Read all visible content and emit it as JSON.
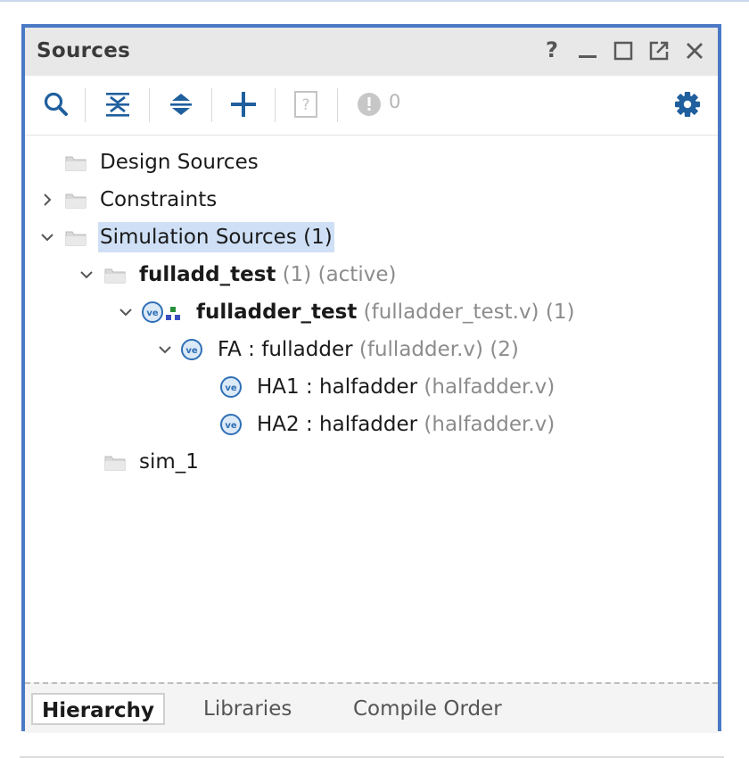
{
  "panel": {
    "title": "Sources",
    "window_controls": [
      "help-icon",
      "minimize-icon",
      "maximize-icon",
      "float-icon",
      "close-icon"
    ],
    "help_label": "?"
  },
  "toolbar": {
    "buttons": [
      "search-icon",
      "collapse-all-icon",
      "expand-all-icon",
      "add-icon",
      "unknown-file-icon",
      "status-dot-icon",
      "gear-icon"
    ],
    "status_count": "0"
  },
  "tree": {
    "design_sources": "Design Sources",
    "constraints": "Constraints",
    "simulation_sources": "Simulation Sources (1)",
    "fileset": {
      "name": "fulladd_test",
      "count": "(1)",
      "state": "(active)"
    },
    "top": {
      "name": "fulladder_test",
      "file": "(fulladder_test.v)",
      "count": "(1)"
    },
    "fa": {
      "name": "FA : fulladder",
      "file": "(fulladder.v)",
      "count": "(2)"
    },
    "ha1": {
      "name": "HA1 : halfadder",
      "file": "(halfadder.v)"
    },
    "ha2": {
      "name": "HA2 : halfadder",
      "file": "(halfadder.v)"
    },
    "sim": "sim_1"
  },
  "tabs": {
    "hierarchy": "Hierarchy",
    "libraries": "Libraries",
    "compile_order": "Compile Order"
  },
  "colors": {
    "accent_border": "#4a79c5",
    "selection": "#cfe0f6",
    "icon_blue": "#1f5f9e"
  }
}
